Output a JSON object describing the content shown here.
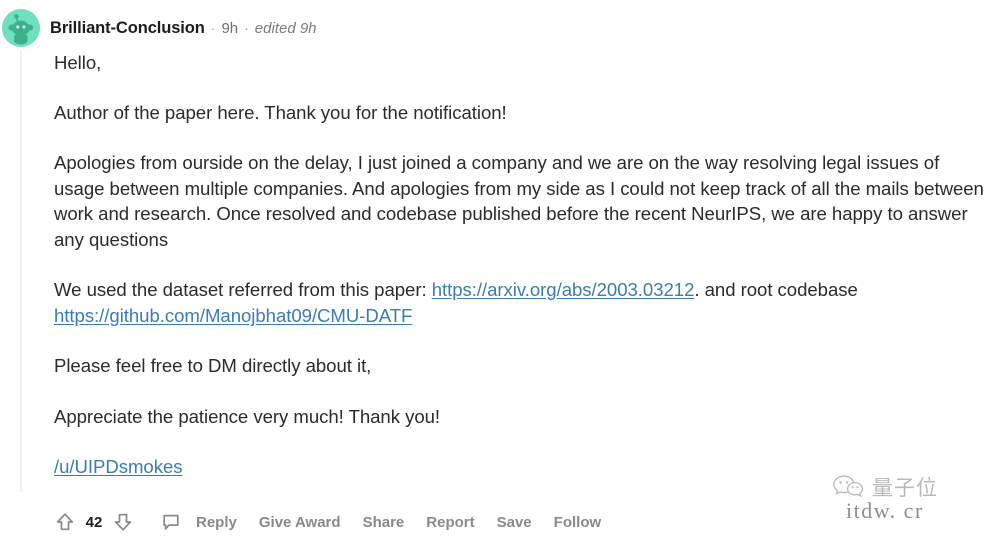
{
  "comment": {
    "author": "Brilliant-Conclusion",
    "separator": "·",
    "timestamp": "9h",
    "edited": "edited 9h",
    "avatar_icon": "reddit-snoo-avatar",
    "avatar_bg_color": "#6ee0bd",
    "avatar_fg_color": "#3faf8b",
    "paragraphs": {
      "p1": "Hello,",
      "p2": "Author of the paper here. Thank you for the notification!",
      "p3": "Apologies from ourside on the delay, I just joined a company and we are on the way resolving legal issues of usage between multiple companies. And apologies from my side as I could not keep track of all the mails between work and research. Once resolved and codebase published before the recent NeurIPS, we are happy to answer any questions",
      "p4_prefix": "We used the dataset referred from this paper: ",
      "p4_link1": "https://arxiv.org/abs/2003.03212",
      "p4_middle": ". and root codebase ",
      "p4_link2": "https://github.com/Manojbhat09/CMU-DATF",
      "p5": "Please feel free to DM directly about it,",
      "p6": "Appreciate the patience very much! Thank you!",
      "p7_userlink": "/u/UIPDsmokes"
    },
    "link_color": "#3b7cb8"
  },
  "actions": {
    "upvote_icon": "upvote-arrow-icon",
    "downvote_icon": "downvote-arrow-icon",
    "comment_icon": "comment-bubble-icon",
    "score": "42",
    "reply_label": "Reply",
    "give_award_label": "Give Award",
    "share_label": "Share",
    "report_label": "Report",
    "save_label": "Save",
    "follow_label": "Follow"
  },
  "watermark": {
    "icon": "wechat-icon",
    "brand_cn": "量子位",
    "url": "itdw. cr"
  }
}
